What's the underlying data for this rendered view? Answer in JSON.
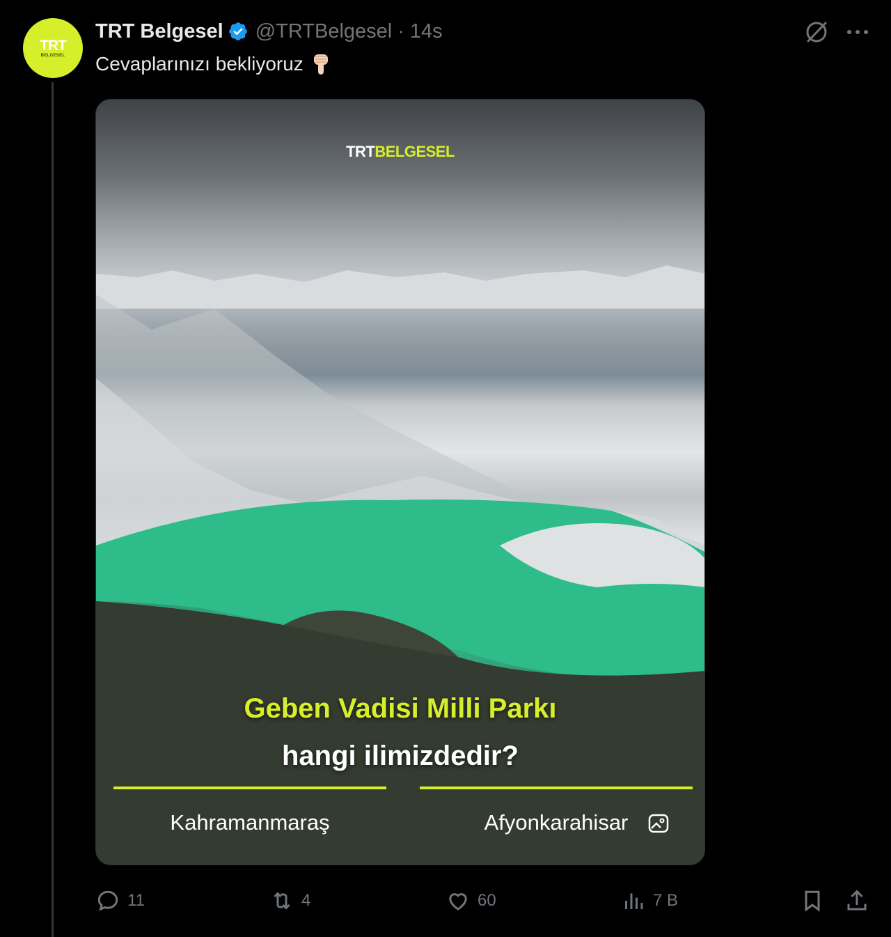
{
  "tweet": {
    "author_name": "TRT Belgesel",
    "handle": "@TRTBelgesel",
    "separator": "·",
    "time": "14s",
    "text": "Cevaplarınızı bekliyoruz",
    "avatar": {
      "line1": "TRT",
      "line2": "BELGESEL",
      "color": "#d7ef2a"
    }
  },
  "media": {
    "logo_white": "TRT",
    "logo_green": "BELGESEL",
    "question_line1": "Geben Vadisi Milli Parkı",
    "question_line2": "hangi ilimizdedir?",
    "option_1": "Kahramanmaraş",
    "option_2": "Afyonkarahisar",
    "accent_color": "#d7ef2a"
  },
  "actions": {
    "replies": "11",
    "reposts": "4",
    "likes": "60",
    "views": "7 B"
  },
  "icons": [
    "verified-badge-icon",
    "grok-icon",
    "more-icon",
    "pointing-down-emoji",
    "alt-image-icon",
    "reply-icon",
    "repost-icon",
    "like-icon",
    "views-icon",
    "bookmark-icon",
    "share-icon"
  ],
  "colors": {
    "background": "#000000",
    "text": "#e7e9ea",
    "muted": "#71767b",
    "verified": "#1d9bf0"
  }
}
